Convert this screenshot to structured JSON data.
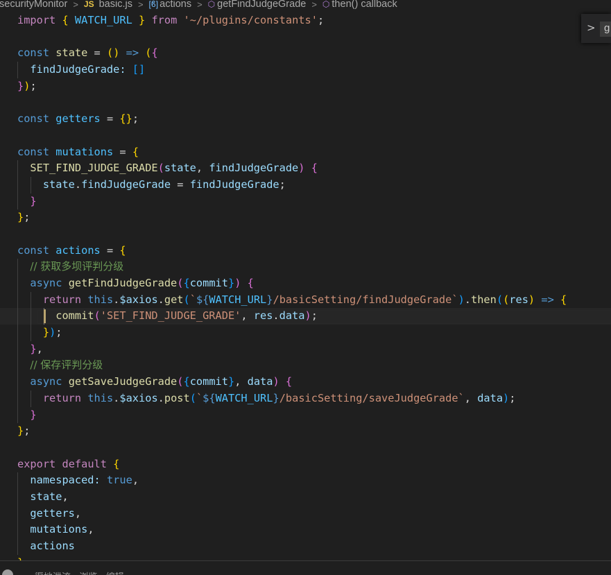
{
  "breadcrumb": [
    {
      "label": "securityMonitor",
      "icon": "folder"
    },
    {
      "label": "basic.js",
      "icon": "js-file-icon",
      "badge": "JS"
    },
    {
      "label": "actions",
      "icon": "variable-icon",
      "glyph": "[ϐ]"
    },
    {
      "label": "getFindJudgeGrade",
      "icon": "method-icon",
      "glyph": "⬡"
    },
    {
      "label": "then() callback",
      "icon": "method-icon",
      "glyph": "⬡"
    }
  ],
  "find_widget": {
    "expand_glyph": ">",
    "query": "g"
  },
  "status": {
    "text": "渠地泄流 · 浏览 · 编辑"
  },
  "colors": {
    "background": "#1f1f1f",
    "keyword": "#569cd6",
    "control": "#c586c0",
    "variable": "#9cdcfe",
    "constant": "#4fc1ff",
    "function": "#dcdcaa",
    "string": "#ce9178",
    "comment": "#6a9955",
    "bracket_level1": "#ffd700",
    "bracket_level2": "#da70d6",
    "bracket_level3": "#179fff"
  },
  "code": {
    "cursor_line": 19,
    "lines": [
      {
        "indent": 0,
        "tokens": [
          [
            "c",
            "import"
          ],
          [
            "p",
            " "
          ],
          [
            "b1",
            "{"
          ],
          [
            "p",
            " "
          ],
          [
            "n",
            "WATCH_URL"
          ],
          [
            "p",
            " "
          ],
          [
            "b1",
            "}"
          ],
          [
            "p",
            " "
          ],
          [
            "c",
            "from"
          ],
          [
            "p",
            " "
          ],
          [
            "s",
            "'~/plugins/constants'"
          ],
          [
            "p",
            ";"
          ]
        ]
      },
      {
        "indent": 0,
        "tokens": []
      },
      {
        "indent": 0,
        "tokens": [
          [
            "k",
            "const"
          ],
          [
            "p",
            " "
          ],
          [
            "f",
            "state"
          ],
          [
            "p",
            " = "
          ],
          [
            "b1",
            "()"
          ],
          [
            "p",
            " "
          ],
          [
            "k",
            "=>"
          ],
          [
            "p",
            " "
          ],
          [
            "b1",
            "("
          ],
          [
            "b2",
            "{"
          ]
        ]
      },
      {
        "indent": 1,
        "tokens": [
          [
            "v",
            "findJudgeGrade"
          ],
          [
            "v",
            ":"
          ],
          [
            "p",
            " "
          ],
          [
            "b3",
            "[]"
          ]
        ]
      },
      {
        "indent": 0,
        "tokens": [
          [
            "b2",
            "}"
          ],
          [
            "b1",
            ")"
          ],
          [
            "p",
            ";"
          ]
        ]
      },
      {
        "indent": 0,
        "tokens": []
      },
      {
        "indent": 0,
        "tokens": [
          [
            "k",
            "const"
          ],
          [
            "p",
            " "
          ],
          [
            "n",
            "getters"
          ],
          [
            "p",
            " = "
          ],
          [
            "b1",
            "{}"
          ],
          [
            "p",
            ";"
          ]
        ]
      },
      {
        "indent": 0,
        "tokens": []
      },
      {
        "indent": 0,
        "tokens": [
          [
            "k",
            "const"
          ],
          [
            "p",
            " "
          ],
          [
            "n",
            "mutations"
          ],
          [
            "p",
            " = "
          ],
          [
            "b1",
            "{"
          ]
        ]
      },
      {
        "indent": 1,
        "tokens": [
          [
            "f",
            "SET_FIND_JUDGE_GRADE"
          ],
          [
            "b2",
            "("
          ],
          [
            "v",
            "state"
          ],
          [
            "p",
            ", "
          ],
          [
            "v",
            "findJudgeGrade"
          ],
          [
            "b2",
            ")"
          ],
          [
            "p",
            " "
          ],
          [
            "b2",
            "{"
          ]
        ]
      },
      {
        "indent": 2,
        "tokens": [
          [
            "v",
            "state"
          ],
          [
            "p",
            "."
          ],
          [
            "v",
            "findJudgeGrade"
          ],
          [
            "p",
            " = "
          ],
          [
            "v",
            "findJudgeGrade"
          ],
          [
            "p",
            ";"
          ]
        ]
      },
      {
        "indent": 1,
        "tokens": [
          [
            "b2",
            "}"
          ]
        ]
      },
      {
        "indent": 0,
        "tokens": [
          [
            "b1",
            "}"
          ],
          [
            "p",
            ";"
          ]
        ]
      },
      {
        "indent": 0,
        "tokens": []
      },
      {
        "indent": 0,
        "tokens": [
          [
            "k",
            "const"
          ],
          [
            "p",
            " "
          ],
          [
            "n",
            "actions"
          ],
          [
            "p",
            " = "
          ],
          [
            "b1",
            "{"
          ]
        ]
      },
      {
        "indent": 1,
        "tokens": [
          [
            "cm",
            "// 获取多坝评判分级"
          ]
        ]
      },
      {
        "indent": 1,
        "tokens": [
          [
            "k",
            "async"
          ],
          [
            "p",
            " "
          ],
          [
            "f",
            "getFindJudgeGrade"
          ],
          [
            "b2",
            "("
          ],
          [
            "b3",
            "{"
          ],
          [
            "v",
            "commit"
          ],
          [
            "b3",
            "}"
          ],
          [
            "b2",
            ")"
          ],
          [
            "p",
            " "
          ],
          [
            "b2",
            "{"
          ]
        ]
      },
      {
        "indent": 2,
        "tokens": [
          [
            "c",
            "return"
          ],
          [
            "p",
            " "
          ],
          [
            "k",
            "this"
          ],
          [
            "p",
            "."
          ],
          [
            "v",
            "$axios"
          ],
          [
            "p",
            "."
          ],
          [
            "f",
            "get"
          ],
          [
            "b3",
            "("
          ],
          [
            "s",
            "`"
          ],
          [
            "k",
            "${"
          ],
          [
            "n",
            "WATCH_URL"
          ],
          [
            "k",
            "}"
          ],
          [
            "s",
            "/basicSetting/findJudgeGrade`"
          ],
          [
            "b3",
            ")"
          ],
          [
            "p",
            "."
          ],
          [
            "f",
            "then"
          ],
          [
            "b3",
            "("
          ],
          [
            "b1",
            "("
          ],
          [
            "v",
            "res"
          ],
          [
            "b1",
            ")"
          ],
          [
            "p",
            " "
          ],
          [
            "k",
            "=>"
          ],
          [
            "p",
            " "
          ],
          [
            "b1",
            "{"
          ]
        ]
      },
      {
        "indent": 3,
        "tokens": [
          [
            "f",
            "commit"
          ],
          [
            "b2",
            "("
          ],
          [
            "s",
            "'SET_FIND_JUDGE_GRADE'"
          ],
          [
            "p",
            ", "
          ],
          [
            "v",
            "res"
          ],
          [
            "p",
            "."
          ],
          [
            "v",
            "data"
          ],
          [
            "b2",
            ")"
          ],
          [
            "p",
            ";"
          ]
        ]
      },
      {
        "indent": 2,
        "tokens": [
          [
            "b1",
            "}"
          ],
          [
            "b3",
            ")"
          ],
          [
            "p",
            ";"
          ]
        ]
      },
      {
        "indent": 1,
        "tokens": [
          [
            "b2",
            "}"
          ],
          [
            "p",
            ","
          ]
        ]
      },
      {
        "indent": 1,
        "tokens": [
          [
            "cm",
            "// 保存评判分级"
          ]
        ]
      },
      {
        "indent": 1,
        "tokens": [
          [
            "k",
            "async"
          ],
          [
            "p",
            " "
          ],
          [
            "f",
            "getSaveJudgeGrade"
          ],
          [
            "b2",
            "("
          ],
          [
            "b3",
            "{"
          ],
          [
            "v",
            "commit"
          ],
          [
            "b3",
            "}"
          ],
          [
            "p",
            ", "
          ],
          [
            "v",
            "data"
          ],
          [
            "b2",
            ")"
          ],
          [
            "p",
            " "
          ],
          [
            "b2",
            "{"
          ]
        ]
      },
      {
        "indent": 2,
        "tokens": [
          [
            "c",
            "return"
          ],
          [
            "p",
            " "
          ],
          [
            "k",
            "this"
          ],
          [
            "p",
            "."
          ],
          [
            "v",
            "$axios"
          ],
          [
            "p",
            "."
          ],
          [
            "f",
            "post"
          ],
          [
            "b3",
            "("
          ],
          [
            "s",
            "`"
          ],
          [
            "k",
            "${"
          ],
          [
            "n",
            "WATCH_URL"
          ],
          [
            "k",
            "}"
          ],
          [
            "s",
            "/basicSetting/saveJudgeGrade`"
          ],
          [
            "p",
            ", "
          ],
          [
            "v",
            "data"
          ],
          [
            "b3",
            ")"
          ],
          [
            "p",
            ";"
          ]
        ]
      },
      {
        "indent": 1,
        "tokens": [
          [
            "b2",
            "}"
          ]
        ]
      },
      {
        "indent": 0,
        "tokens": [
          [
            "b1",
            "}"
          ],
          [
            "p",
            ";"
          ]
        ]
      },
      {
        "indent": 0,
        "tokens": []
      },
      {
        "indent": 0,
        "tokens": [
          [
            "c",
            "export"
          ],
          [
            "p",
            " "
          ],
          [
            "c",
            "default"
          ],
          [
            "p",
            " "
          ],
          [
            "b1",
            "{"
          ]
        ]
      },
      {
        "indent": 1,
        "tokens": [
          [
            "v",
            "namespaced"
          ],
          [
            "v",
            ":"
          ],
          [
            "p",
            " "
          ],
          [
            "k",
            "true"
          ],
          [
            "p",
            ","
          ]
        ]
      },
      {
        "indent": 1,
        "tokens": [
          [
            "v",
            "state"
          ],
          [
            "p",
            ","
          ]
        ]
      },
      {
        "indent": 1,
        "tokens": [
          [
            "v",
            "getters"
          ],
          [
            "p",
            ","
          ]
        ]
      },
      {
        "indent": 1,
        "tokens": [
          [
            "v",
            "mutations"
          ],
          [
            "p",
            ","
          ]
        ]
      },
      {
        "indent": 1,
        "tokens": [
          [
            "v",
            "actions"
          ]
        ]
      },
      {
        "indent": 0,
        "tokens": [
          [
            "b1",
            "}"
          ],
          [
            "p",
            ";"
          ]
        ]
      }
    ]
  }
}
